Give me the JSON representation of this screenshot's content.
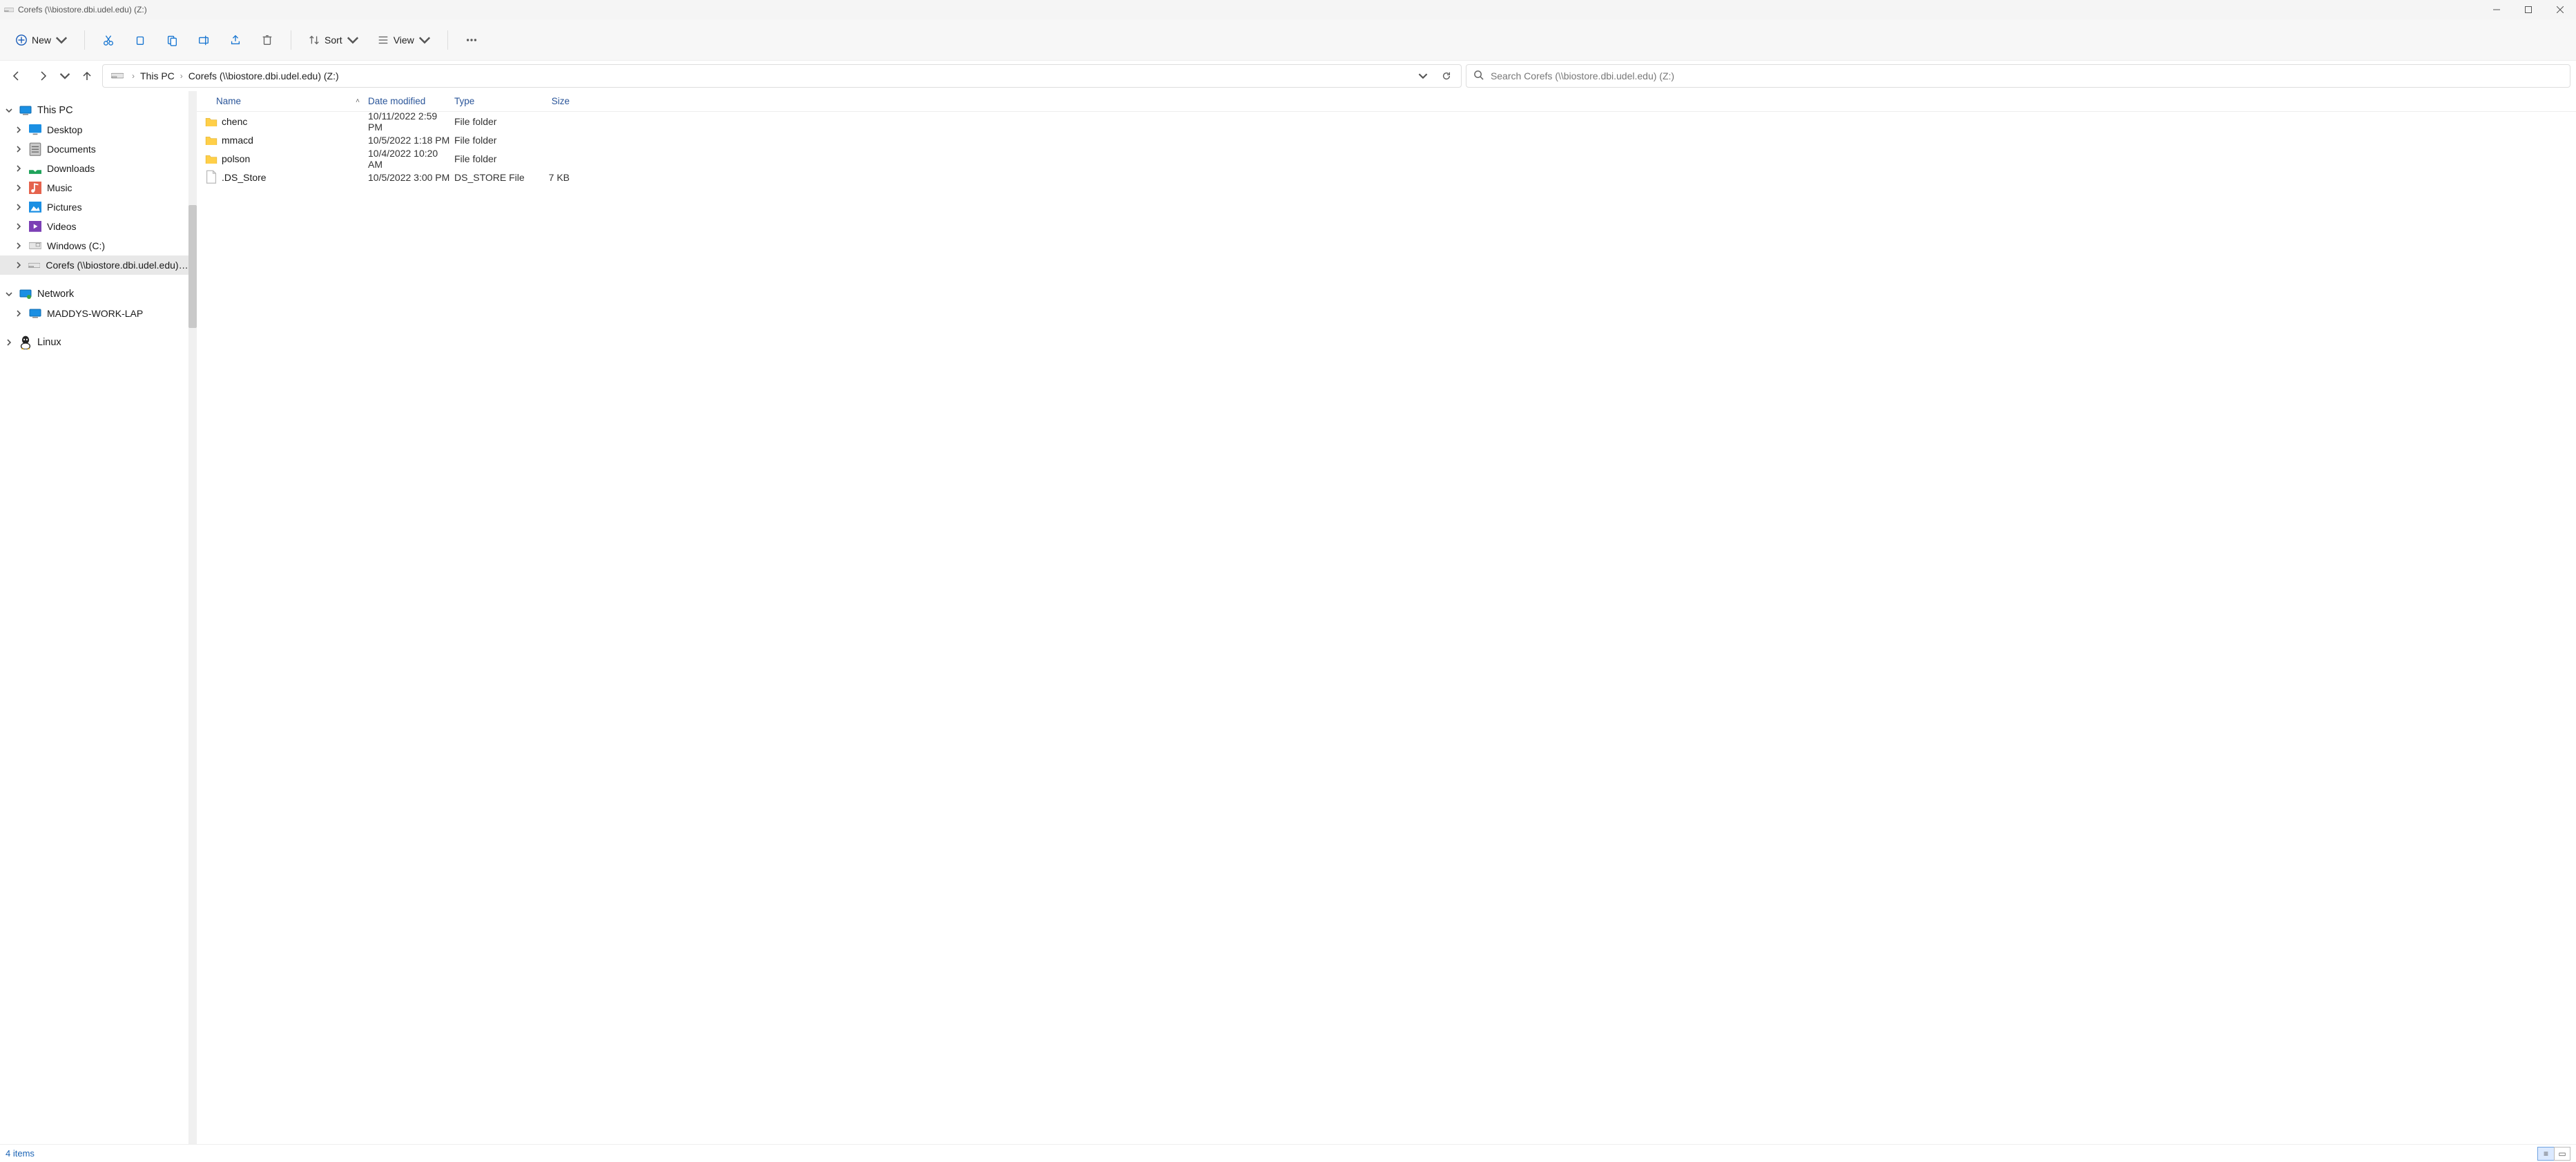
{
  "titlebar": {
    "title": "Corefs (\\\\biostore.dbi.udel.edu) (Z:)"
  },
  "toolbar": {
    "new_label": "New",
    "sort_label": "Sort",
    "view_label": "View"
  },
  "address": {
    "crumb1": "This PC",
    "crumb2": "Corefs (\\\\biostore.dbi.udel.edu) (Z:)"
  },
  "search": {
    "placeholder": "Search Corefs (\\\\biostore.dbi.udel.edu) (Z:)"
  },
  "sidebar": {
    "this_pc": "This PC",
    "items": [
      "Desktop",
      "Documents",
      "Downloads",
      "Music",
      "Pictures",
      "Videos",
      "Windows (C:)",
      "Corefs (\\\\biostore.dbi.udel.edu) (Z:)"
    ],
    "network": "Network",
    "net_items": [
      "MADDYS-WORK-LAP"
    ],
    "linux": "Linux"
  },
  "columns": {
    "name": "Name",
    "date": "Date modified",
    "type": "Type",
    "size": "Size"
  },
  "rows": [
    {
      "name": "chenc",
      "date": "10/11/2022 2:59 PM",
      "type": "File folder",
      "size": "",
      "kind": "folder"
    },
    {
      "name": "mmacd",
      "date": "10/5/2022 1:18 PM",
      "type": "File folder",
      "size": "",
      "kind": "folder"
    },
    {
      "name": "polson",
      "date": "10/4/2022 10:20 AM",
      "type": "File folder",
      "size": "",
      "kind": "folder"
    },
    {
      "name": ".DS_Store",
      "date": "10/5/2022 3:00 PM",
      "type": "DS_STORE File",
      "size": "7 KB",
      "kind": "file"
    }
  ],
  "status": {
    "text": "4 items"
  }
}
